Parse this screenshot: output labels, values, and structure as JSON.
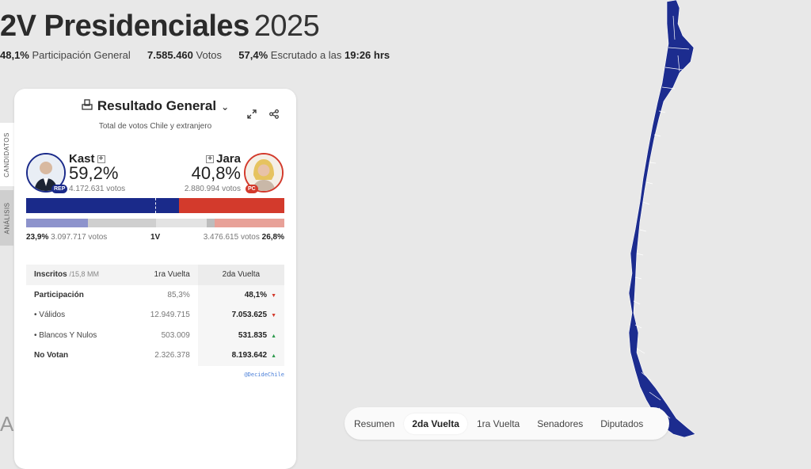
{
  "header": {
    "title": "2V Presidenciales",
    "year": "2025",
    "participation_pct": "48,1%",
    "participation_label": "Participación General",
    "votes_total": "7.585.460",
    "votes_label": "Votos",
    "scrutinized_pct": "57,4%",
    "scrutinized_label": "Escrutado a las",
    "time": "19:26 hrs"
  },
  "side_tabs": {
    "candidates": "CANDIDATOS",
    "analysis": "ANÁLISIS"
  },
  "panel": {
    "title": "Resultado General",
    "subtitle": "Total de votos Chile y extranjero",
    "left": {
      "name": "Kast",
      "pct": "59,2%",
      "votes": "4.172.631 votos",
      "party": "REP",
      "color": "#1a2a8a",
      "share": 0.592
    },
    "right": {
      "name": "Jara",
      "pct": "40,8%",
      "votes": "2.880.994 votos",
      "party": "PC",
      "color": "#d33a2c",
      "share": 0.408
    },
    "first_round": {
      "label": "1V",
      "left_pct": "23,9%",
      "left_votes": "3.097.717 votos",
      "right_votes": "3.476.615 votos",
      "right_pct": "26,8%"
    },
    "table": {
      "headers": {
        "inscritos": "Inscritos",
        "inscritos_sub": "/15,8 MM",
        "col1": "1ra Vuelta",
        "col2": "2da Vuelta"
      },
      "rows": [
        {
          "label": "Participación",
          "v1": "85,3%",
          "v2": "48,1%",
          "trend": "▼"
        },
        {
          "label": "• Válidos",
          "v1": "12.949.715",
          "v2": "7.053.625",
          "trend": "▼"
        },
        {
          "label": "• Blancos Y Nulos",
          "v1": "503.009",
          "v2": "531.835",
          "trend": "▲"
        },
        {
          "label": "No Votan",
          "v1": "2.326.378",
          "v2": "8.193.642",
          "trend": "▲"
        }
      ]
    },
    "credit": "@DecideChile"
  },
  "bottom_letter": "A",
  "nav": {
    "items": [
      "Resumen",
      "2da Vuelta",
      "1ra Vuelta",
      "Senadores",
      "Diputados"
    ],
    "active": "2da Vuelta"
  },
  "map": {
    "fill": "#1c2c8f",
    "border": "#ffffff"
  }
}
